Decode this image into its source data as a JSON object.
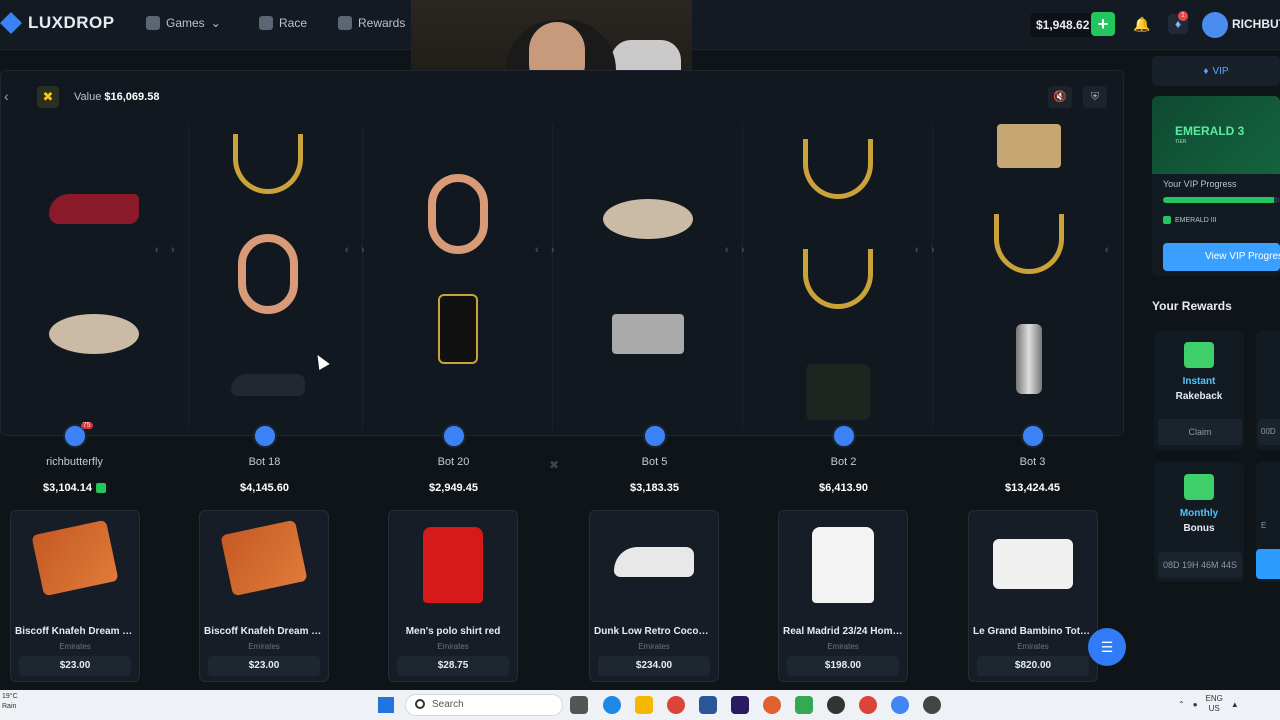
{
  "header": {
    "brand": "LUXDROP",
    "nav": [
      {
        "label": "Games",
        "icon": "gamepad-icon",
        "has_dropdown": true
      },
      {
        "label": "Race",
        "icon": "flag-icon"
      },
      {
        "label": "Rewards",
        "icon": "gift-icon"
      }
    ],
    "balance": "$1,948.62",
    "deposit_symbol": "+",
    "notification_count": "1",
    "username": "RICHBUTT"
  },
  "battle": {
    "value_prefix": "Value",
    "value_amount": "$16,069.58",
    "players": [
      {
        "name": "richbutterfly",
        "total": "$3,104.14",
        "level": "75",
        "verified": true
      },
      {
        "name": "Bot 18",
        "total": "$4,145.60"
      },
      {
        "name": "Bot 20",
        "total": "$2,949.45"
      },
      {
        "name": "Bot 5",
        "total": "$3,183.35"
      },
      {
        "name": "Bot 2",
        "total": "$6,413.90"
      },
      {
        "name": "Bot 3",
        "total": "$13,424.45"
      }
    ],
    "won_items": [
      {
        "name": "Biscoff Knafeh Dream Bar",
        "sub": "Emirates",
        "price": "$23.00",
        "image": "chocolate-bar"
      },
      {
        "name": "Biscoff Knafeh Dream Bar",
        "sub": "Emirates",
        "price": "$23.00",
        "image": "chocolate-bar"
      },
      {
        "name": "Men's polo shirt red",
        "sub": "Emirates",
        "price": "$28.75",
        "image": "red-polo-shirt"
      },
      {
        "name": "Dunk Low Retro Coconut...",
        "sub": "Emirates",
        "price": "$234.00",
        "image": "white-sneaker"
      },
      {
        "name": "Real Madrid 23/24 Home...",
        "sub": "Emirates",
        "price": "$198.00",
        "image": "white-jersey"
      },
      {
        "name": "Le Grand Bambino Tote B...",
        "sub": "Emirates",
        "price": "$820.00",
        "image": "white-tote-bag"
      }
    ]
  },
  "sidebar": {
    "vip_tab": "VIP",
    "tier": "EMERALD 3",
    "tier_sub": "TIER",
    "progress_label": "Your VIP Progress",
    "progress_fraction": 0.95,
    "tier_chip": "EMERALD III",
    "vip_button": "View VIP Progress",
    "rewards_title": "Your Rewards",
    "rewards": [
      {
        "title": "Instant",
        "subtitle": "Rakeback",
        "action": "Claim"
      },
      {
        "title": "Monthly",
        "subtitle": "Bonus",
        "action": "08D 19H 46M 44S"
      }
    ],
    "edge_labels": [
      "00D",
      "E"
    ]
  },
  "taskbar": {
    "weather_temp": "19°C",
    "weather_desc": "Rain",
    "search_placeholder": "Search",
    "lang_1": "ENG",
    "lang_2": "US"
  },
  "colors": {
    "background": "#0f1419",
    "accent_green": "#22c55e",
    "accent_blue": "#3aa0ff",
    "gold": "#c9a33a"
  }
}
